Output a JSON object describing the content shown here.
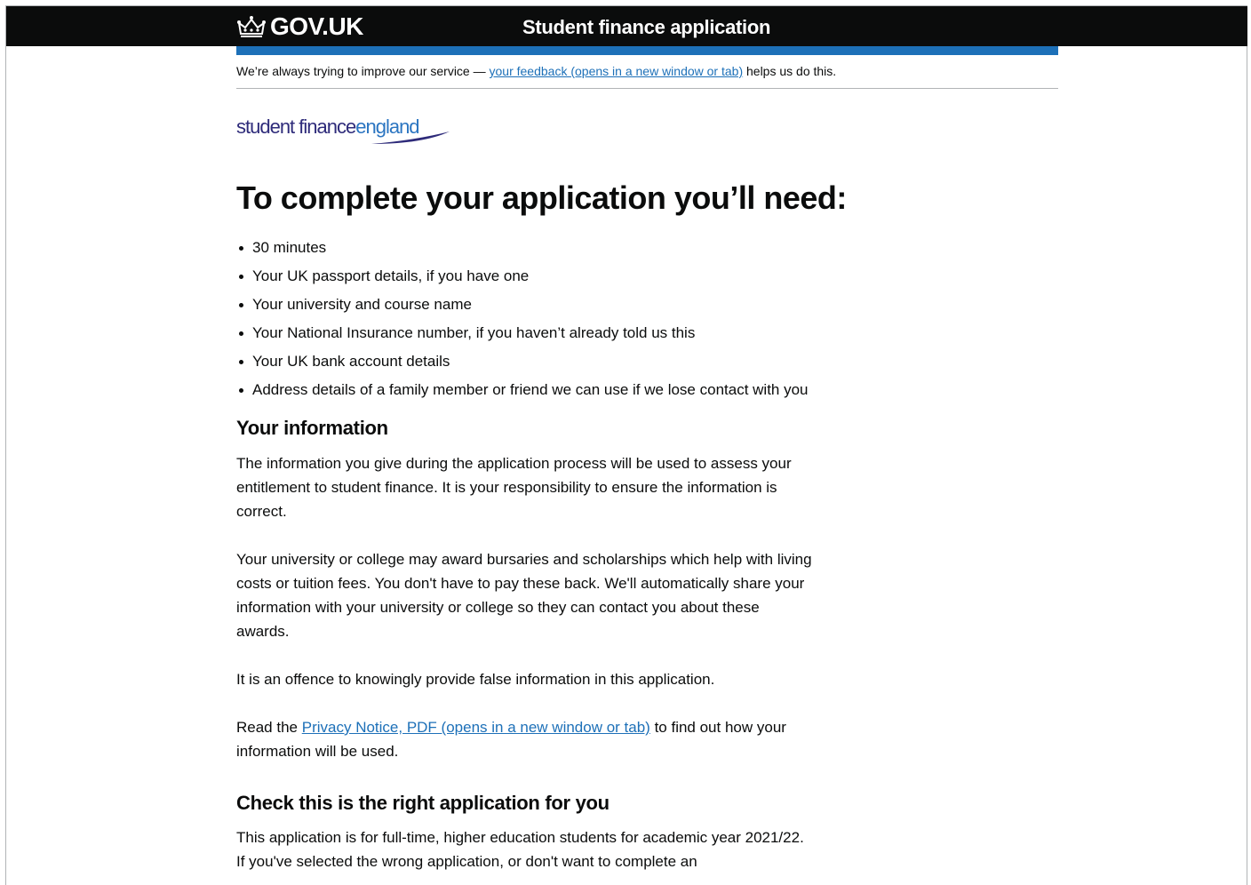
{
  "header": {
    "logo_text": "GOV.UK",
    "service_name": "Student finance application"
  },
  "phase_banner": {
    "before": "We’re always trying to improve our service — ",
    "link": "your feedback (opens in a new window or tab)",
    "after": " helps us do this."
  },
  "brand_logo": {
    "part1": "student finance",
    "part2": "england"
  },
  "page_title": "To complete your application you’ll need:",
  "needs": [
    "30 minutes",
    "Your UK passport details, if you have one",
    "Your university and course name",
    "Your National Insurance number, if you haven’t already told us this",
    "Your UK bank account details",
    "Address details of a family member or friend we can use if we lose contact with you"
  ],
  "your_information": {
    "heading": "Your information",
    "p1": "The information you give during the application process will be used to assess your entitlement to student finance. It is your responsibility to ensure the information is correct.",
    "p2": "Your university or college may award bursaries and scholarships which help with living costs or tuition fees. You don't have to pay these back. We'll automatically share your information with your university or college so they can contact you about these awards.",
    "p3": "It is an offence to knowingly provide false information in this application.",
    "p4_before": "Read the ",
    "p4_link": "Privacy Notice, PDF (opens in a new window or tab)",
    "p4_after": " to find out how your information will be used."
  },
  "check_section": {
    "heading": "Check this is the right application for you",
    "p1": "This application is for full-time, higher education students for academic year 2021/22. If you've selected the wrong application, or don't want to complete an"
  },
  "colors": {
    "header_bg": "#0b0c0c",
    "brand_blue": "#1d70b8",
    "link": "#1d70b8",
    "text": "#0b0c0c"
  }
}
